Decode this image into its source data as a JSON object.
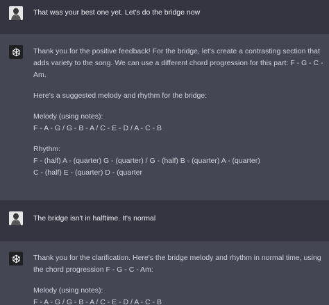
{
  "conversation": {
    "user_1": {
      "text": "That was your best one yet. Let's do the bridge now"
    },
    "assistant_1": {
      "p1_line1": "Thank you for the positive feedback! For the bridge, let's create a contrasting section that",
      "p1_line2": "adds variety to the song. We can use a different chord progression for this part: F - G - C -",
      "p1_line3": "Am.",
      "p2": "Here's a suggested melody and rhythm for the bridge:",
      "melody_label": "Melody (using notes):",
      "melody_notes": "F - A - G / G - B - A / C - E - D / A - C - B",
      "rhythm_label": "Rhythm:",
      "rhythm_line1": "F - (half) A - (quarter) G - (quarter) / G - (half) B - (quarter) A - (quarter)",
      "rhythm_line2": "C - (half) E - (quarter) D - (quarter"
    },
    "user_2": {
      "text": "The bridge isn't in halftime. It's normal"
    },
    "assistant_2": {
      "p1_line1": "Thank you for the clarification. Here's the bridge melody and rhythm in normal time, using",
      "p1_line2": "the chord progression F - G - C - Am:",
      "melody_label": "Melody (using notes):",
      "melody_notes": "F - A - G / G - B - A / C - E - D / A - C - B"
    }
  },
  "icons": {
    "user_avatar": "user-photo-avatar",
    "assistant_avatar": "openai-logo-icon"
  },
  "colors": {
    "background": "#343541",
    "assistant_background": "#444654",
    "text": "#d1d5db"
  }
}
